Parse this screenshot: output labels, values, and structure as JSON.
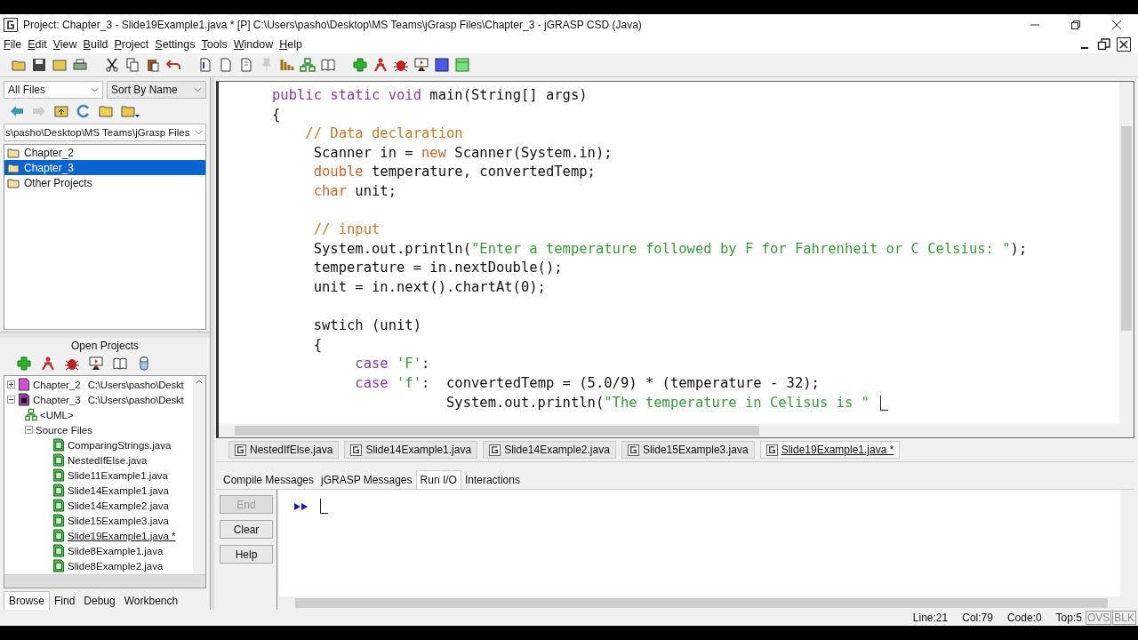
{
  "window": {
    "title": "Project: Chapter_3  - Slide19Example1.java * [P]  C:\\Users\\pasho\\Desktop\\MS Teams\\jGrasp Files\\Chapter_3 - jGRASP CSD (Java)"
  },
  "menu": [
    "File",
    "Edit",
    "View",
    "Build",
    "Project",
    "Settings",
    "Tools",
    "Window",
    "Help"
  ],
  "browse": {
    "filter": "All Files",
    "sort": "Sort By Name",
    "path": "s\\pasho\\Desktop\\MS Teams\\jGrasp Files",
    "folders": [
      {
        "label": "Chapter_2",
        "selected": false
      },
      {
        "label": "Chapter_3",
        "selected": true
      },
      {
        "label": "Other Projects",
        "selected": false
      }
    ]
  },
  "open_projects": {
    "title": "Open Projects",
    "tree": [
      {
        "kind": "project",
        "label": "Chapter_2",
        "path": "C:\\Users\\pasho\\Deskt",
        "color": "#d050d0",
        "expanded": false
      },
      {
        "kind": "project",
        "label": "Chapter_3",
        "path": "C:\\Users\\pasho\\Deskt",
        "color": "#9a3a9a",
        "expanded": true,
        "children": [
          {
            "kind": "uml",
            "label": "<UML>"
          },
          {
            "kind": "folder",
            "label": "Source Files",
            "expanded": true,
            "children": [
              {
                "kind": "file",
                "label": "ComparingStrings.java",
                "active": false
              },
              {
                "kind": "file",
                "label": "NestedIfElse.java",
                "active": false
              },
              {
                "kind": "file",
                "label": "Slide11Example1.java",
                "active": false
              },
              {
                "kind": "file",
                "label": "Slide14Example1.java",
                "active": false
              },
              {
                "kind": "file",
                "label": "Slide14Example2.java",
                "active": false
              },
              {
                "kind": "file",
                "label": "Slide15Example3.java",
                "active": false
              },
              {
                "kind": "file",
                "label": "Slide19Example1.java *",
                "active": true
              },
              {
                "kind": "file",
                "label": "Slide8Example1.java",
                "active": false
              },
              {
                "kind": "file",
                "label": "Slide8Example2.java",
                "active": false
              }
            ]
          }
        ]
      }
    ]
  },
  "left_tabs": [
    {
      "label": "Browse",
      "selected": true
    },
    {
      "label": "Find",
      "selected": false
    },
    {
      "label": "Debug",
      "selected": false
    },
    {
      "label": "Workbench",
      "selected": false
    }
  ],
  "editor": {
    "caret": true,
    "lines": [
      {
        "kind": "code",
        "segments": [
          {
            "kind": "keyword",
            "text": "public static void"
          },
          {
            "kind": "plain",
            "text": " main(String[] args)"
          }
        ]
      },
      {
        "kind": "code",
        "segments": [
          {
            "kind": "plain",
            "text": "{"
          }
        ]
      },
      {
        "kind": "code",
        "segments": [
          {
            "kind": "comment",
            "text": "    // Data declaration"
          }
        ]
      },
      {
        "kind": "code",
        "segments": [
          {
            "kind": "plain",
            "text": "     Scanner in = "
          },
          {
            "kind": "type",
            "text": "new"
          },
          {
            "kind": "plain",
            "text": " Scanner(System.in);"
          }
        ]
      },
      {
        "kind": "code",
        "segments": [
          {
            "kind": "type",
            "text": "     double"
          },
          {
            "kind": "plain",
            "text": " temperature, convertedTemp;"
          }
        ]
      },
      {
        "kind": "code",
        "segments": [
          {
            "kind": "type",
            "text": "     char"
          },
          {
            "kind": "plain",
            "text": " unit;"
          }
        ]
      },
      {
        "kind": "blank"
      },
      {
        "kind": "code",
        "segments": [
          {
            "kind": "comment",
            "text": "     // input"
          }
        ]
      },
      {
        "kind": "code",
        "segments": [
          {
            "kind": "plain",
            "text": "     System.out.println("
          },
          {
            "kind": "string",
            "text": "\"Enter a temperature followed by F for Fahrenheit or C Celsius: \""
          },
          {
            "kind": "plain",
            "text": ");"
          }
        ]
      },
      {
        "kind": "code",
        "segments": [
          {
            "kind": "plain",
            "text": "     temperature = in.nextDouble();"
          }
        ]
      },
      {
        "kind": "code",
        "segments": [
          {
            "kind": "plain",
            "text": "     unit = in.next().chartAt(0);"
          }
        ]
      },
      {
        "kind": "blank"
      },
      {
        "kind": "code",
        "segments": [
          {
            "kind": "plain",
            "text": "     swtich (unit)"
          }
        ]
      },
      {
        "kind": "code",
        "segments": [
          {
            "kind": "plain",
            "text": "     {"
          }
        ]
      },
      {
        "kind": "code",
        "segments": [
          {
            "kind": "keyword",
            "text": "          case"
          },
          {
            "kind": "string",
            "text": " 'F'"
          },
          {
            "kind": "plain",
            "text": ":"
          }
        ]
      },
      {
        "kind": "code",
        "segments": [
          {
            "kind": "keyword",
            "text": "          case"
          },
          {
            "kind": "string",
            "text": " 'f'"
          },
          {
            "kind": "plain",
            "text": ":  convertedTemp = (5.0/9) * (temperature - 32);"
          }
        ]
      },
      {
        "kind": "code",
        "segments": [
          {
            "kind": "plain",
            "text": "                     System.out.println("
          },
          {
            "kind": "string",
            "text": "\"The temperature in Celisus is \""
          }
        ]
      }
    ]
  },
  "file_tabs": [
    {
      "label": "NestedIfElse.java",
      "selected": false
    },
    {
      "label": "Slide14Example1.java",
      "selected": false
    },
    {
      "label": "Slide14Example2.java",
      "selected": false
    },
    {
      "label": "Slide15Example3.java",
      "selected": false
    },
    {
      "label": "Slide19Example1.java *",
      "selected": true
    }
  ],
  "message_tabs": [
    {
      "label": "Compile Messages",
      "selected": false
    },
    {
      "label": "jGRASP Messages",
      "selected": false
    },
    {
      "label": "Run I/O",
      "selected": true
    },
    {
      "label": "Interactions",
      "selected": false
    }
  ],
  "run_buttons": [
    {
      "label": "End",
      "disabled": true
    },
    {
      "label": "Clear",
      "disabled": false
    },
    {
      "label": "Help",
      "disabled": false
    }
  ],
  "console": {
    "caret": true
  },
  "status_bar": {
    "items": [
      "Line:21",
      "Col:79",
      "Code:0",
      "Top:5"
    ],
    "modes": [
      "OVS",
      "BLK"
    ]
  }
}
